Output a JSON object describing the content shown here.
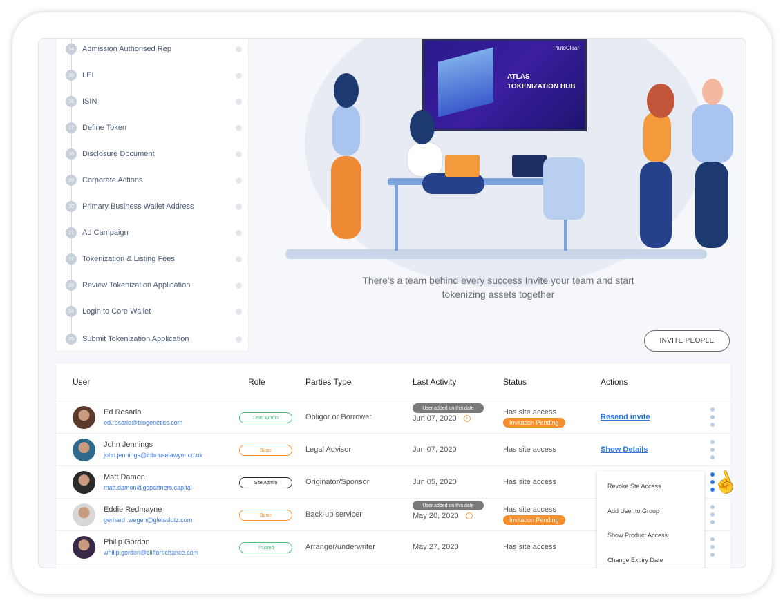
{
  "sidebar": {
    "steps": [
      {
        "num": "14",
        "label": "Admission Authorised Rep"
      },
      {
        "num": "15",
        "label": "LEI"
      },
      {
        "num": "16",
        "label": "ISIN"
      },
      {
        "num": "17",
        "label": "Define Token"
      },
      {
        "num": "18",
        "label": "Disclosure Document"
      },
      {
        "num": "19",
        "label": "Corporate Actions"
      },
      {
        "num": "20",
        "label": "Primary Business Wallet Address"
      },
      {
        "num": "21",
        "label": "Ad Campaign"
      },
      {
        "num": "22",
        "label": "Tokenization & Listing  Fees"
      },
      {
        "num": "23",
        "label": "Review Tokenization Application"
      },
      {
        "num": "24",
        "label": "Login to Core Wallet"
      },
      {
        "num": "25",
        "label": "Submit Tokenization Application"
      }
    ]
  },
  "hero": {
    "screen_brand": "PlutoClear",
    "screen_title_1": "ATLAS",
    "screen_title_2": "TOKENIZATION HUB",
    "caption_1": "There's a team behind every  success Invite your team and start",
    "caption_2": "tokenizing assets together"
  },
  "invite_button": "INVITE PEOPLE",
  "table": {
    "headers": {
      "user": "User",
      "role": "Role",
      "parties": "Parties Type",
      "activity": "Last Activity",
      "status": "Status",
      "actions": "Actions"
    },
    "rows": [
      {
        "name": "Ed Rosario",
        "email": "ed.rosario@biogenetics.com",
        "role": "Lead Admin",
        "role_color": "#4cbf7e",
        "party": "Obligor or Borrower",
        "tip": "User added on this date",
        "date": "Jun 07, 2020",
        "status": "Has site access",
        "pending": "Invitation Pending",
        "action": "Resend invite"
      },
      {
        "name": "John Jennings",
        "email": "john.jennings@inhouselawyer.co.uk",
        "role": "Basic",
        "role_color": "#f7902c",
        "party": "Legal Advisor",
        "date": "Jun 07, 2020",
        "status": "Has site access",
        "action": "Show Details"
      },
      {
        "name": "Matt Damon",
        "email": "matt.damon@gcpartners.capital",
        "role": "Site Admin",
        "role_color": "#222222",
        "party": "Originator/Sponsor",
        "date": "Jun 05, 2020",
        "status": "Has site access"
      },
      {
        "name": "Eddie Redmayne",
        "email": "gerhard .wegen@gleisslutz.com",
        "role": "Basic",
        "role_color": "#f7902c",
        "party": "Back-up servicer",
        "tip": "User added on this date",
        "date": "May 20, 2020",
        "status": "Has site access",
        "pending": "Invitation Pending"
      },
      {
        "name": "Philip Gordon",
        "email": "whilip.gordon@cliffordchance.com",
        "role": "Trusted",
        "role_color": "#4cbf7e",
        "party": "Arranger/underwriter",
        "date": "May 27, 2020",
        "status": "Has site access"
      }
    ]
  },
  "context_menu": [
    "Revoke Ste Access",
    "Add User to Group",
    "Show Product Access",
    "Change Expiry Date"
  ]
}
